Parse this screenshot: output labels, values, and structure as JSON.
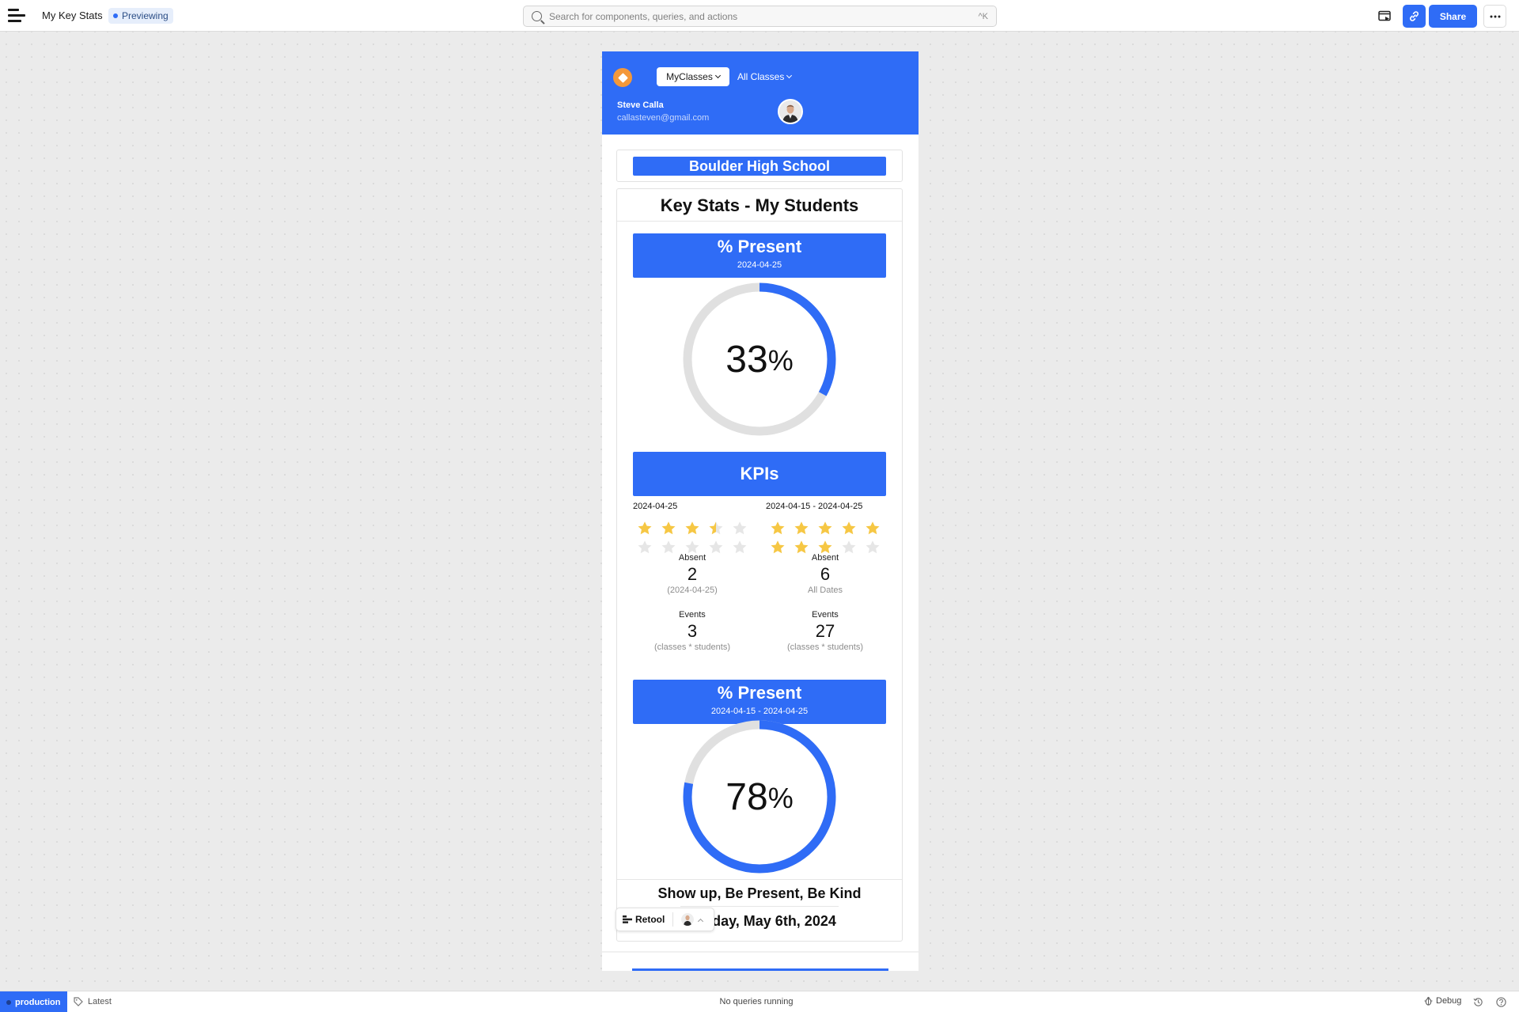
{
  "topbar": {
    "app_title": "My Key Stats",
    "status_badge": "Previewing",
    "search_placeholder": "Search for components, queries, and actions",
    "search_shortcut": "^K",
    "share_label": "Share"
  },
  "app": {
    "header": {
      "myclasses_label": "MyClasses",
      "allclasses_label": "All Classes",
      "user_name": "Steve Calla",
      "user_email": "callasteven@gmail.com"
    },
    "school_name": "Boulder High School",
    "stats_title": "Key Stats - My Students",
    "present_daily": {
      "title": "% Present",
      "date": "2024-04-25",
      "value": 33,
      "value_text": "33",
      "unit": "%"
    },
    "kpis": {
      "title": "KPIs",
      "left": {
        "date": "2024-04-25",
        "rating": 3.5,
        "max": 10,
        "absent_label": "Absent",
        "absent_value": "2",
        "absent_note": "(2024-04-25)",
        "events_label": "Events",
        "events_value": "3",
        "events_note": "(classes * students)"
      },
      "right": {
        "date": "2024-04-15 - 2024-04-25",
        "rating": 8,
        "max": 10,
        "absent_label": "Absent",
        "absent_value": "6",
        "absent_note": "All Dates",
        "events_label": "Events",
        "events_value": "27",
        "events_note": "(classes * students)"
      }
    },
    "present_range": {
      "title": "% Present",
      "date": "2024-04-15 - 2024-04-25",
      "value": 78,
      "value_text": "78",
      "unit": "%"
    },
    "motto": "Show up, Be Present, Be Kind",
    "date_line": "Monday, May 6th, 2024"
  },
  "retool_pill": {
    "label": "Retool"
  },
  "bottombar": {
    "environment": "production",
    "version_label": "Latest",
    "status_text": "No queries running",
    "debug_label": "Debug"
  },
  "colors": {
    "accent": "#2f6cf6",
    "logo": "#f4983a",
    "star_filled": "#f6c744",
    "star_empty": "#e6e6e6",
    "gauge_track": "#e0e0e0"
  }
}
